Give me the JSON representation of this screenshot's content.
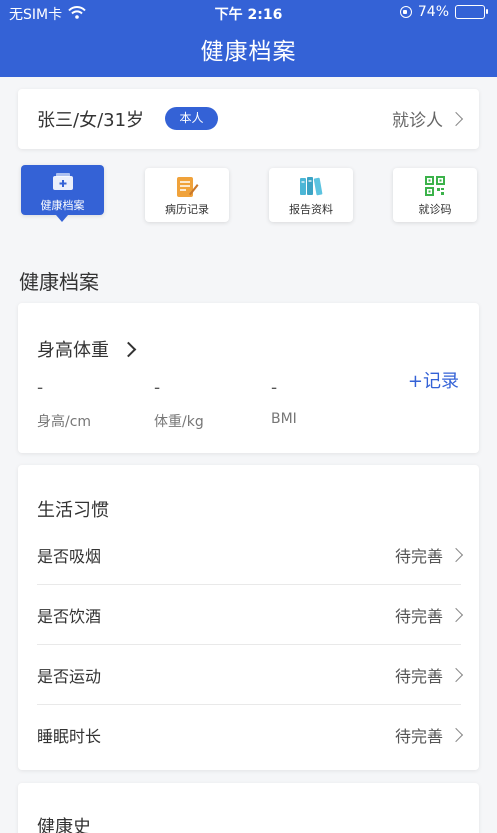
{
  "status_bar": {
    "carrier": "无SIM卡",
    "time": "下午 2:16",
    "battery": "74%",
    "battery_level": 0.74
  },
  "header": {
    "title": "健康档案"
  },
  "patient": {
    "name_info": "张三/女/31岁",
    "badge": "本人",
    "link_label": "就诊人"
  },
  "quick_nav": [
    {
      "label": "健康档案",
      "icon": "health-record-icon",
      "active": true
    },
    {
      "label": "病历记录",
      "icon": "medical-record-icon",
      "active": false
    },
    {
      "label": "报告资料",
      "icon": "report-books-icon",
      "active": false
    },
    {
      "label": "就诊码",
      "icon": "qr-code-icon",
      "active": false
    }
  ],
  "section": {
    "title": "健康档案"
  },
  "height_weight": {
    "title": "身高体重",
    "record_label": "+记录",
    "metrics": [
      {
        "value": "-",
        "label": "身高/cm"
      },
      {
        "value": "-",
        "label": "体重/kg"
      },
      {
        "value": "-",
        "label": "BMI"
      }
    ]
  },
  "lifestyle": {
    "title": "生活习惯",
    "rows": [
      {
        "label": "是否吸烟",
        "status": "待完善"
      },
      {
        "label": "是否饮酒",
        "status": "待完善"
      },
      {
        "label": "是否运动",
        "status": "待完善"
      },
      {
        "label": "睡眠时长",
        "status": "待完善"
      }
    ]
  },
  "history": {
    "title": "健康史"
  },
  "colors": {
    "primary": "#3462d6",
    "battery_fill": "#4cd964"
  }
}
